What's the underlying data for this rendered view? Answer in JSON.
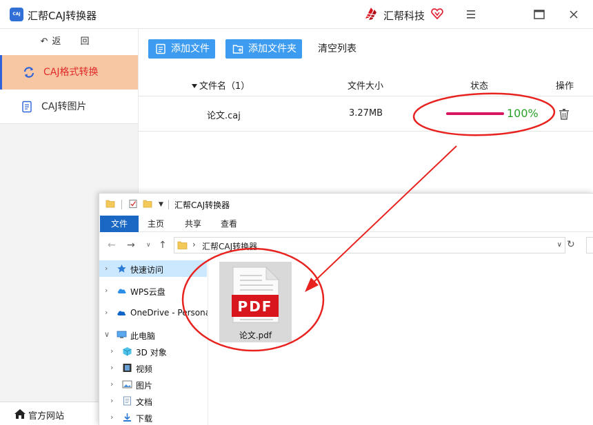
{
  "app": {
    "title": "汇帮CAJ转换器",
    "logo_text": "CAJ",
    "brand": "汇帮科技"
  },
  "sidebar": {
    "back": "返 回",
    "items": [
      {
        "label": "CAJ格式转换",
        "icon": "refresh-icon",
        "active": true
      },
      {
        "label": "CAJ转图片",
        "icon": "document-icon",
        "active": false
      }
    ],
    "footer": "官方网站"
  },
  "toolbar": {
    "add_file": "添加文件",
    "add_folder": "添加文件夹",
    "clear_list": "清空列表"
  },
  "table": {
    "columns": {
      "name": "文件名（1）",
      "size": "文件大小",
      "status": "状态",
      "op": "操作"
    },
    "rows": [
      {
        "name": "论文.caj",
        "size": "3.27MB",
        "progress_percent": 100,
        "status": "100%"
      }
    ]
  },
  "explorer": {
    "title": "汇帮CAJ转换器",
    "tabs": [
      "文件",
      "主页",
      "共享",
      "查看"
    ],
    "address": "汇帮CAJ转换器",
    "tree": [
      "快速访问",
      "WPS云盘",
      "OneDrive - Persona",
      "此电脑",
      "3D 对象",
      "视频",
      "图片",
      "文档",
      "下载"
    ],
    "file": {
      "label": "论文.pdf",
      "badge": "PDF"
    }
  },
  "colors": {
    "accent_blue": "#3d9cf0",
    "active_nav_bg": "#f7c7a3",
    "active_nav_text": "#e22a2a",
    "progress": "#d8155f",
    "success": "#27a127",
    "annotation_red": "#e8231f",
    "pdf_red": "#d7161e"
  }
}
